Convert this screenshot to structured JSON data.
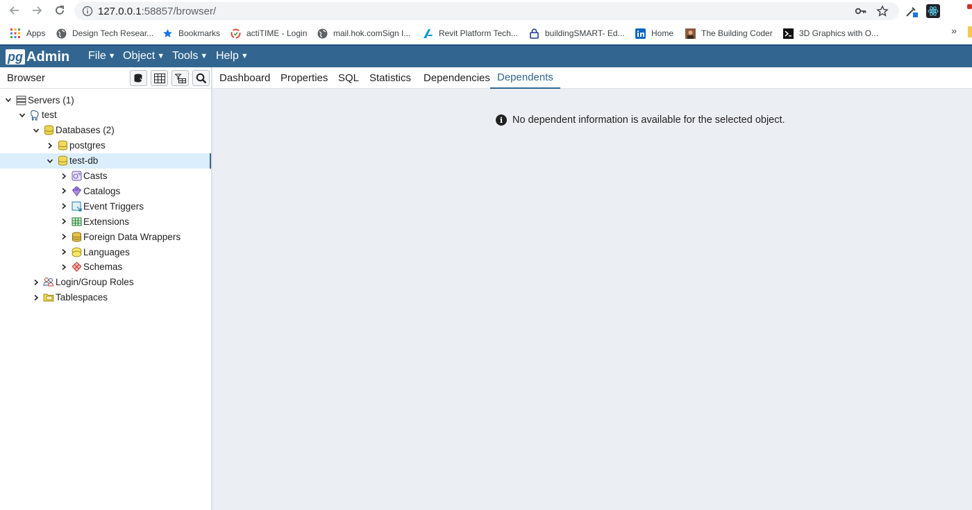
{
  "browser": {
    "url_host": "127.0.0.1",
    "url_path": ":58857/browser/",
    "bookmarks": [
      {
        "label": "Apps",
        "icon": "apps-grid-icon"
      },
      {
        "label": "Design Tech Resear...",
        "icon": "globe-icon"
      },
      {
        "label": "Bookmarks",
        "icon": "star-icon"
      },
      {
        "label": "actiTIME - Login",
        "icon": "actitime-icon"
      },
      {
        "label": "mail.hok.comSign I...",
        "icon": "globe-icon"
      },
      {
        "label": "Revit Platform Tech...",
        "icon": "autodesk-icon"
      },
      {
        "label": "buildingSMART- Ed...",
        "icon": "lock-site-icon"
      },
      {
        "label": "Home",
        "icon": "linkedin-icon"
      },
      {
        "label": "The Building Coder",
        "icon": "avatar-icon"
      },
      {
        "label": "3D Graphics with O...",
        "icon": "terminal-icon"
      }
    ],
    "more": "»"
  },
  "app": {
    "logo_pg": "pg",
    "logo_admin": "Admin",
    "menus": [
      "File",
      "Object",
      "Tools",
      "Help"
    ]
  },
  "browser_panel": {
    "title": "Browser",
    "tree": [
      {
        "label": "Servers (1)",
        "level": 0,
        "expanded": true,
        "icon": "servers-icon"
      },
      {
        "label": "test",
        "level": 1,
        "expanded": true,
        "icon": "elephant-icon"
      },
      {
        "label": "Databases (2)",
        "level": 2,
        "expanded": true,
        "icon": "databases-icon"
      },
      {
        "label": "postgres",
        "level": 3,
        "expanded": false,
        "icon": "database-icon"
      },
      {
        "label": "test-db",
        "level": 3,
        "expanded": true,
        "selected": true,
        "icon": "database-icon"
      },
      {
        "label": "Casts",
        "level": 4,
        "expanded": false,
        "icon": "casts-icon"
      },
      {
        "label": "Catalogs",
        "level": 4,
        "expanded": false,
        "icon": "catalogs-icon"
      },
      {
        "label": "Event Triggers",
        "level": 4,
        "expanded": false,
        "icon": "event-triggers-icon"
      },
      {
        "label": "Extensions",
        "level": 4,
        "expanded": false,
        "icon": "extensions-icon"
      },
      {
        "label": "Foreign Data Wrappers",
        "level": 4,
        "expanded": false,
        "icon": "fdw-icon"
      },
      {
        "label": "Languages",
        "level": 4,
        "expanded": false,
        "icon": "languages-icon"
      },
      {
        "label": "Schemas",
        "level": 4,
        "expanded": false,
        "icon": "schemas-icon"
      },
      {
        "label": "Login/Group Roles",
        "level": 2,
        "expanded": false,
        "icon": "roles-icon"
      },
      {
        "label": "Tablespaces",
        "level": 2,
        "expanded": false,
        "icon": "tablespaces-icon"
      }
    ]
  },
  "tabs": [
    {
      "label": "Dashboard",
      "active": false
    },
    {
      "label": "Properties",
      "active": false
    },
    {
      "label": "SQL",
      "active": false
    },
    {
      "label": "Statistics",
      "active": false
    },
    {
      "label": "Dependencies",
      "active": false
    },
    {
      "label": "Dependents",
      "active": true
    }
  ],
  "content": {
    "message": "No dependent information is available for the selected object."
  },
  "colors": {
    "header": "#326690",
    "content_bg": "#ebeef3",
    "selected_row": "#dbeefc"
  }
}
